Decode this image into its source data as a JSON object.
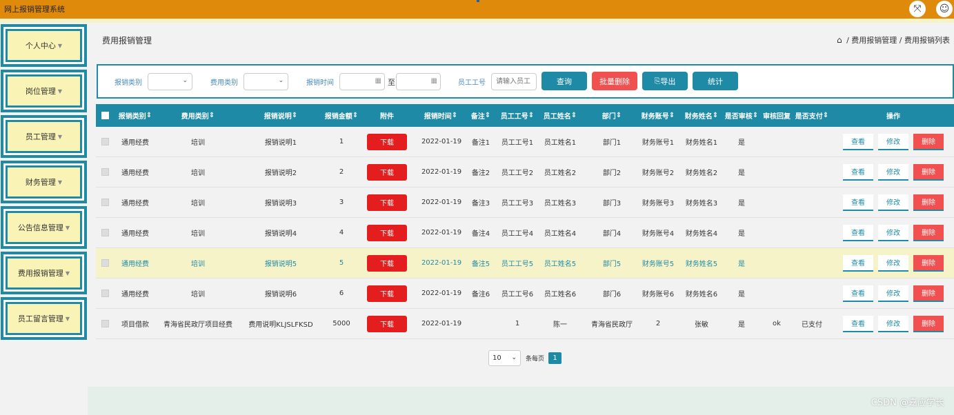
{
  "app": {
    "title": "网上报销管理系统",
    "fullscreen_icon": "fullscreen-icon",
    "user_icon": "user-icon"
  },
  "sidebar": {
    "items": [
      {
        "label": "个人中心"
      },
      {
        "label": "岗位管理"
      },
      {
        "label": "员工管理"
      },
      {
        "label": "财务管理"
      },
      {
        "label": "公告信息管理"
      },
      {
        "label": "费用报销管理"
      },
      {
        "label": "员工留言管理"
      }
    ]
  },
  "header": {
    "page_title": "费用报销管理",
    "breadcrumb": [
      "费用报销管理",
      "费用报销列表"
    ],
    "breadcrumb_separator": "/"
  },
  "filters": {
    "reimb_type_label": "报销类别",
    "reimb_type_value": "",
    "expense_type_label": "费用类别",
    "expense_type_value": "",
    "time_label": "报销时间",
    "time_from": "",
    "time_to_label": "至",
    "time_to": "",
    "emp_no_label": "员工工号",
    "emp_no_placeholder": "请输入员工",
    "query_button": "查询",
    "batch_delete_button": "批量删除",
    "export_button": "导出",
    "stats_button": "统计"
  },
  "table": {
    "headers": [
      "报销类别",
      "费用类别",
      "报销说明",
      "报销金额",
      "附件",
      "报销时间",
      "备注",
      "员工工号",
      "员工姓名",
      "部门",
      "财务账号",
      "财务姓名",
      "是否审核",
      "审核回复",
      "是否支付",
      "操作"
    ],
    "download_label": "下载",
    "view_label": "查看",
    "edit_label": "修改",
    "delete_label": "删除",
    "rows": [
      {
        "type": "通用经费",
        "expense": "培训",
        "desc": "报销说明1",
        "amount": "1",
        "time": "2022-01-19",
        "note": "备注1",
        "emp_no": "员工工号1",
        "emp_name": "员工姓名1",
        "dept": "部门1",
        "fin_acc": "财务账号1",
        "fin_name": "财务姓名1",
        "audited": "是",
        "reply": "",
        "paid": ""
      },
      {
        "type": "通用经费",
        "expense": "培训",
        "desc": "报销说明2",
        "amount": "2",
        "time": "2022-01-19",
        "note": "备注2",
        "emp_no": "员工工号2",
        "emp_name": "员工姓名2",
        "dept": "部门2",
        "fin_acc": "财务账号2",
        "fin_name": "财务姓名2",
        "audited": "是",
        "reply": "",
        "paid": ""
      },
      {
        "type": "通用经费",
        "expense": "培训",
        "desc": "报销说明3",
        "amount": "3",
        "time": "2022-01-19",
        "note": "备注3",
        "emp_no": "员工工号3",
        "emp_name": "员工姓名3",
        "dept": "部门3",
        "fin_acc": "财务账号3",
        "fin_name": "财务姓名3",
        "audited": "是",
        "reply": "",
        "paid": ""
      },
      {
        "type": "通用经费",
        "expense": "培训",
        "desc": "报销说明4",
        "amount": "4",
        "time": "2022-01-19",
        "note": "备注4",
        "emp_no": "员工工号4",
        "emp_name": "员工姓名4",
        "dept": "部门4",
        "fin_acc": "财务账号4",
        "fin_name": "财务姓名4",
        "audited": "是",
        "reply": "",
        "paid": ""
      },
      {
        "type": "通用经费",
        "expense": "培训",
        "desc": "报销说明5",
        "amount": "5",
        "time": "2022-01-19",
        "note": "备注5",
        "emp_no": "员工工号5",
        "emp_name": "员工姓名5",
        "dept": "部门5",
        "fin_acc": "财务账号5",
        "fin_name": "财务姓名5",
        "audited": "是",
        "reply": "",
        "paid": ""
      },
      {
        "type": "通用经费",
        "expense": "培训",
        "desc": "报销说明6",
        "amount": "6",
        "time": "2022-01-19",
        "note": "备注6",
        "emp_no": "员工工号6",
        "emp_name": "员工姓名6",
        "dept": "部门6",
        "fin_acc": "财务账号6",
        "fin_name": "财务姓名6",
        "audited": "是",
        "reply": "",
        "paid": ""
      },
      {
        "type": "项目借款",
        "expense": "青海省民政厅项目经费",
        "desc": "费用说明KLJSLFKSD",
        "amount": "5000",
        "time": "2022-01-19",
        "note": "",
        "emp_no": "1",
        "emp_name": "陈一",
        "dept": "青海省民政厅",
        "fin_acc": "2",
        "fin_name": "张敏",
        "audited": "是",
        "reply": "ok",
        "paid": "已支付"
      }
    ]
  },
  "pager": {
    "page_size": "10",
    "per_page_label": "条每页",
    "current_page": "1"
  },
  "watermark": "CSDN @嘉应学长",
  "colors": {
    "topbar": "#e08a0c",
    "accent": "#1e8aa6",
    "danger": "#f05050",
    "download": "#e41e1e",
    "highlight_row": "#f6f3c8"
  }
}
